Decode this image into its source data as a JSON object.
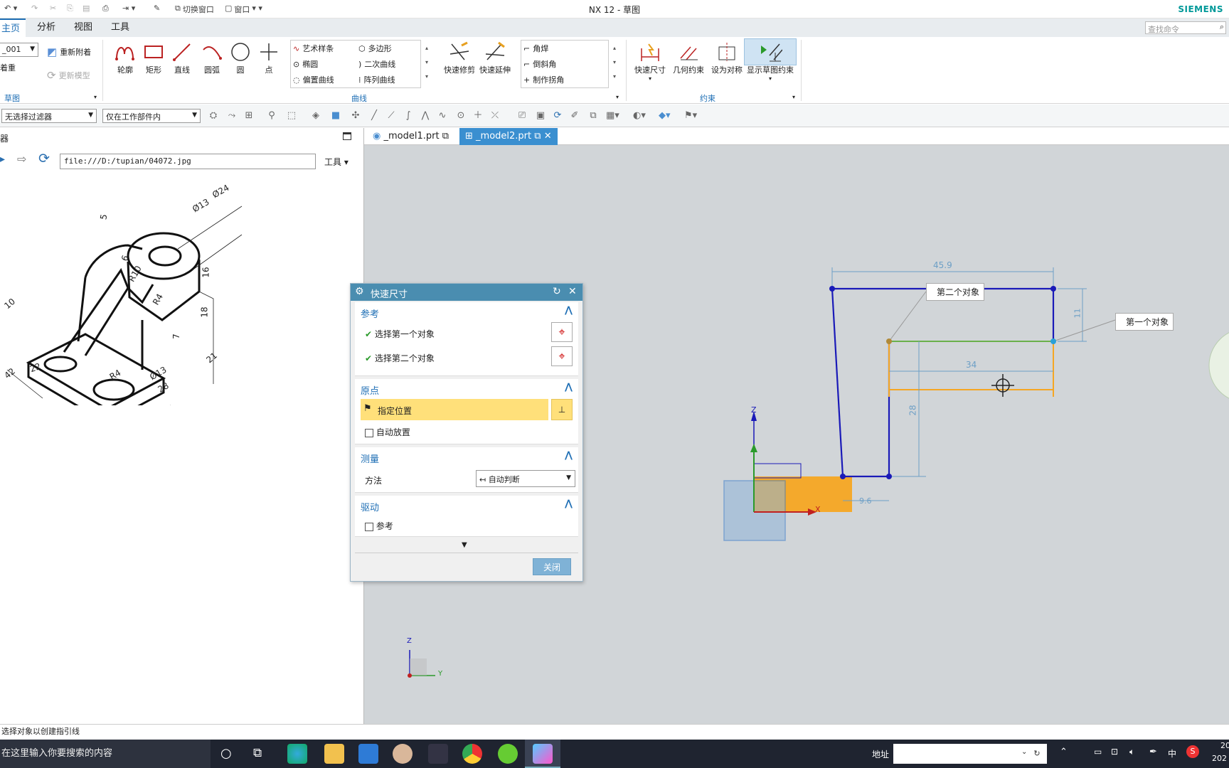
{
  "app": {
    "title": "NX 12 - 草图",
    "brand": "SIEMENS"
  },
  "quick_access": {
    "switch_window": "切换窗口",
    "window": "窗口"
  },
  "ribbon_tabs": [
    "主页",
    "分析",
    "视图",
    "工具"
  ],
  "search_placeholder": "查找命令",
  "ribbon": {
    "sketch_name": "_001",
    "reattach": "重新附着",
    "attach_left": "着重",
    "update_model": "更新模型",
    "sketch_group": "草图",
    "tools": [
      "轮廓",
      "矩形",
      "直线",
      "圆弧",
      "圆",
      "点"
    ],
    "curve_items": [
      "艺术样条",
      "椭圆",
      "偏置曲线",
      "多边形",
      "二次曲线",
      "阵列曲线"
    ],
    "curve_group": "曲线",
    "edit_tools": [
      "快速修剪",
      "快速延伸"
    ],
    "corner_items": [
      "角焊",
      "倒斜角",
      "制作拐角"
    ],
    "constraint_tools": [
      "快速尺寸",
      "几何约束",
      "设为对称",
      "显示草图约束"
    ],
    "constraint_group": "约束"
  },
  "filterbar": {
    "filter": "无选择过滤器",
    "scope": "仅在工作部件内"
  },
  "left_pane": {
    "title": "器",
    "url": "file:///D:/tupian/04072.jpg",
    "tools": "工具"
  },
  "drawing_dims": [
    "Ø24",
    "Ø13",
    "5",
    "16",
    "18",
    "6",
    "R10",
    "R4",
    "10",
    "7",
    "22",
    "21",
    "42",
    "Ø13",
    "28",
    "R4"
  ],
  "doc_tabs": [
    "_model1.prt",
    "_model2.prt"
  ],
  "dialog": {
    "title": "快速尺寸",
    "sec_ref": "参考",
    "first_obj": "选择第一个对象",
    "second_obj": "选择第二个对象",
    "sec_origin": "原点",
    "specify_loc": "指定位置",
    "auto_place": "自动放置",
    "sec_measure": "测量",
    "method_lbl": "方法",
    "method_val": "自动判断",
    "sec_drive": "驱动",
    "ref": "参考",
    "close": "关闭"
  },
  "sketch": {
    "dim_top": "45.9",
    "dim_mid": "34",
    "dim_right": "11",
    "dim_left": "28",
    "dim_bottom": "9.6",
    "callout_second": "第二个对象",
    "callout_first": "第一个对象",
    "axis_z": "Z",
    "axis_x": "X",
    "axis_y": "Y"
  },
  "status": "选择对象以创建指引线",
  "taskbar": {
    "search": "在这里输入你要搜索的内容",
    "address": "地址",
    "ime": "中",
    "clock1": "20",
    "clock2": "202"
  },
  "colors": {
    "accent": "#1f6fb5",
    "dialog_header": "#4a8db0",
    "highlight": "#ffe07a",
    "sketch_orange": "#f5a623",
    "sketch_blue": "#1a1ab8"
  }
}
